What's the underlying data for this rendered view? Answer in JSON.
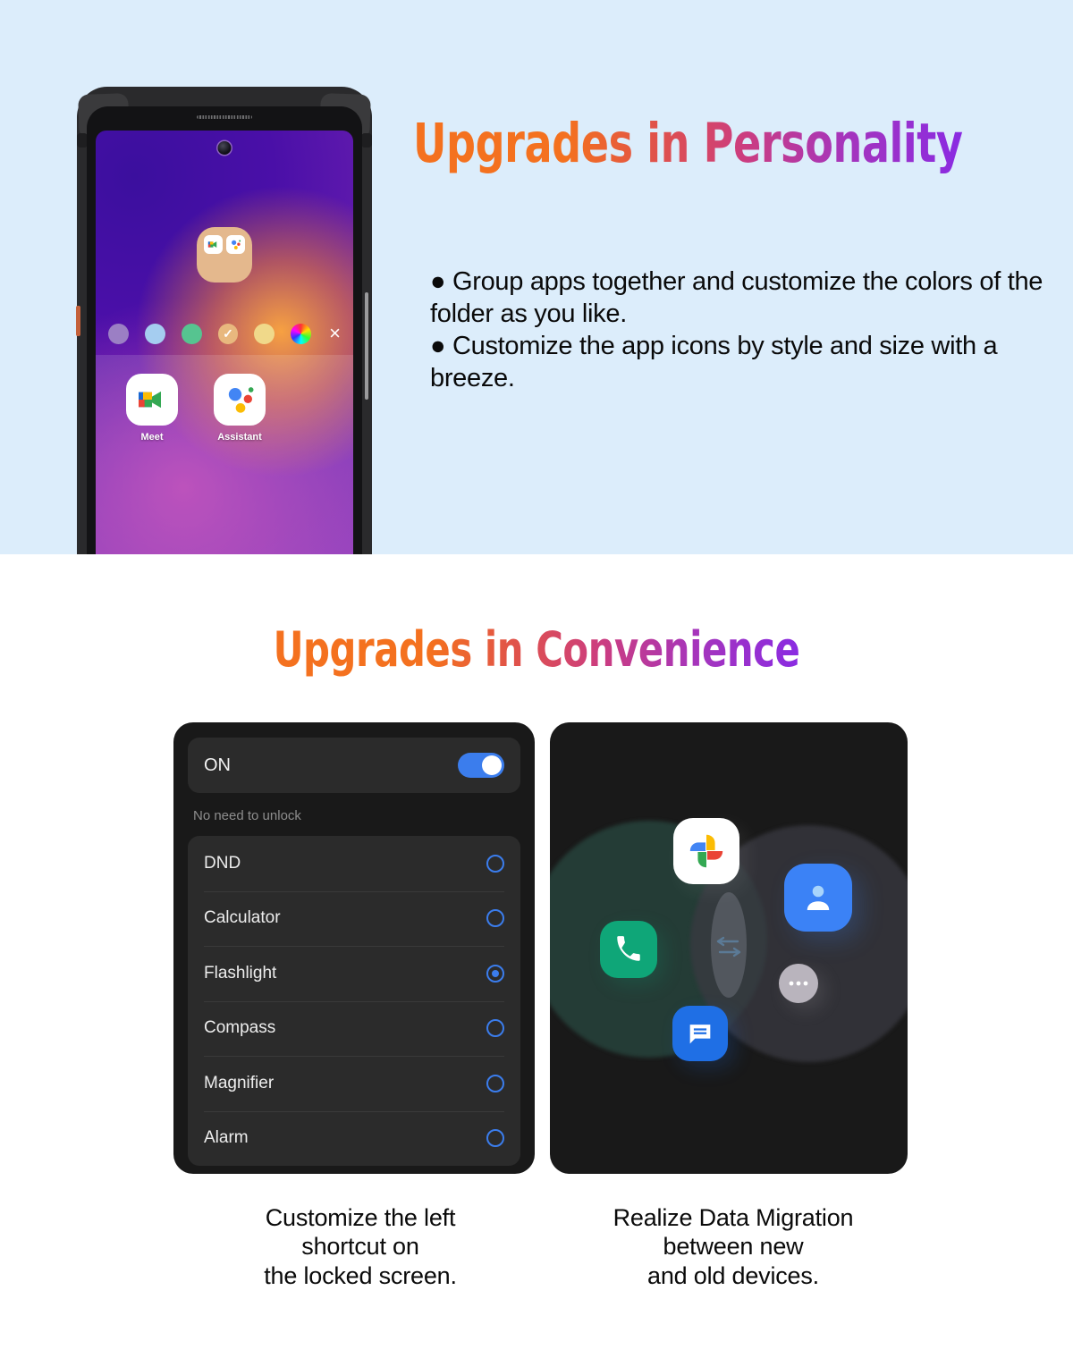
{
  "section1": {
    "background_color": "#dcedfb",
    "title": "Upgrades in Personality",
    "bullets": [
      "● Group apps together and customize the colors of the folder as you like.",
      "● Customize the app icons by style and size with a breeze."
    ],
    "phone": {
      "folder": {
        "apps": [
          "meet-icon",
          "assistant-icon"
        ],
        "color": "#e4b88d"
      },
      "color_swatches": [
        {
          "name": "purple",
          "hex": "#9b7fc4",
          "selected": false
        },
        {
          "name": "light-blue",
          "hex": "#a5cdf0",
          "selected": false
        },
        {
          "name": "green",
          "hex": "#56c490",
          "selected": false
        },
        {
          "name": "tan",
          "hex": "#e8b87e",
          "selected": true,
          "check": "✓"
        },
        {
          "name": "yellow",
          "hex": "#f0d98a",
          "selected": false
        },
        {
          "name": "rainbow",
          "hex": "rainbow",
          "selected": false
        }
      ],
      "close_label": "×",
      "apps": [
        {
          "label": "Meet",
          "icon": "google-meet-icon"
        },
        {
          "label": "Assistant",
          "icon": "google-assistant-icon"
        }
      ]
    }
  },
  "section2": {
    "title": "Upgrades in Convenience",
    "settings": {
      "toggle_label": "ON",
      "toggle_on": true,
      "note": "No need to unlock",
      "items": [
        {
          "label": "DND",
          "selected": false
        },
        {
          "label": "Calculator",
          "selected": false
        },
        {
          "label": "Flashlight",
          "selected": true
        },
        {
          "label": "Compass",
          "selected": false
        },
        {
          "label": "Magnifier",
          "selected": false
        },
        {
          "label": "Alarm",
          "selected": false
        }
      ],
      "accent_color": "#3b7ded"
    },
    "migration": {
      "icons": [
        {
          "name": "google-photos-icon"
        },
        {
          "name": "phone-dialer-icon"
        },
        {
          "name": "contacts-icon"
        },
        {
          "name": "messages-icon"
        },
        {
          "name": "more-dots-icon"
        }
      ],
      "transfer_indicator": "two-way-arrows-icon"
    },
    "captions": {
      "left": "Customize the left\nshortcut on\nthe locked screen.",
      "right": "Realize Data Migration\nbetween new\nand old devices."
    }
  }
}
